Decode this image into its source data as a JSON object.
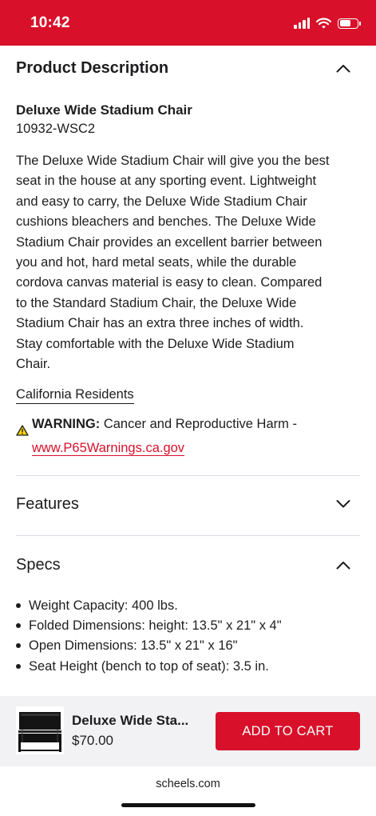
{
  "status_bar": {
    "time": "10:42"
  },
  "product_description": {
    "title": "Product Description",
    "name": "Deluxe Wide Stadium Chair",
    "sku": "10932-WSC2",
    "description_lines": [
      "The Deluxe Wide Stadium Chair will give you the best",
      "seat in the house at any sporting event. Lightweight",
      "and easy to carry, the Deluxe Wide Stadium Chair",
      "cushions bleachers and benches. The Deluxe Wide",
      "Stadium Chair provides an excellent barrier between",
      "you and hot, hard metal seats, while the durable",
      "cordova canvas material is easy to clean. Compared",
      "to the Standard Stadium Chair, the Deluxe Wide",
      "Stadium Chair has an extra three inches of width.",
      "Stay comfortable with the Deluxe Wide Stadium",
      "Chair."
    ],
    "california_link": "California Residents",
    "warning_label": "WARNING:",
    "warning_text": "Cancer and Reproductive Harm -",
    "warning_link": "www.P65Warnings.ca.gov"
  },
  "features": {
    "title": "Features"
  },
  "specs": {
    "title": "Specs",
    "items": [
      "Weight Capacity: 400 lbs.",
      "Folded Dimensions: height: 13.5\"  x 21\"  x 4\"",
      "Open Dimensions: 13.5\"  x 21\"  x 16\"",
      "Seat Height (bench to top of seat): 3.5 in."
    ]
  },
  "sticky_bar": {
    "product_name": "Deluxe Wide Sta...",
    "price": "$70.00",
    "add_to_cart": "ADD TO CART"
  },
  "browser": {
    "url": "scheels.com"
  },
  "colors": {
    "brand_red": "#d8102a",
    "sticky_bg": "#f2f2f4",
    "divider": "#d9dde6"
  },
  "icons": [
    "signal-icon",
    "wifi-icon",
    "battery-icon",
    "chevron-up-icon",
    "chevron-down-icon",
    "warning-icon",
    "chair-image"
  ]
}
